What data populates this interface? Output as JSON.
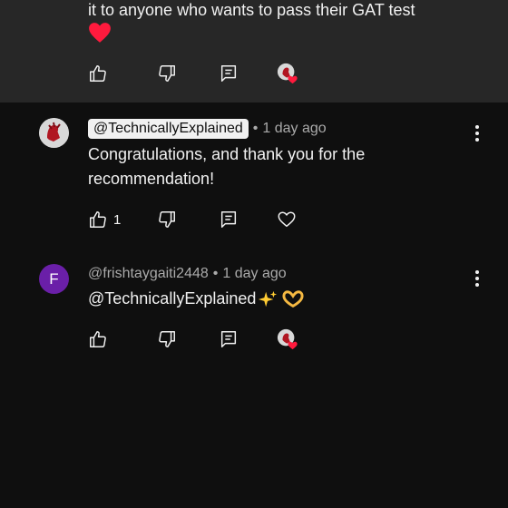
{
  "top_comment": {
    "text_line": "it to anyone who wants to pass their GAT test",
    "emoji": "heart"
  },
  "reply1": {
    "handle": "@TechnicallyExplained",
    "separator": "•",
    "time": "1 day ago",
    "text_line1": "Congratulations, and thank you for the",
    "text_line2": "recommendation!",
    "like_count": "1"
  },
  "reply2": {
    "avatar_letter": "F",
    "handle": "@frishtaygaiti2448",
    "separator": "•",
    "time": "1 day ago",
    "text": "@TechnicallyExplained",
    "emojis": "sparkles, heart-hands"
  },
  "colors": {
    "background": "#0f0f0f",
    "highlight_background": "#272727",
    "heart": "#ff0033",
    "avatar_purple": "#6a1fa8"
  },
  "icons": [
    "thumbs-up-icon",
    "thumbs-down-icon",
    "reply-icon",
    "creator-heart-icon",
    "heart-outline-icon",
    "more-vert-icon"
  ]
}
